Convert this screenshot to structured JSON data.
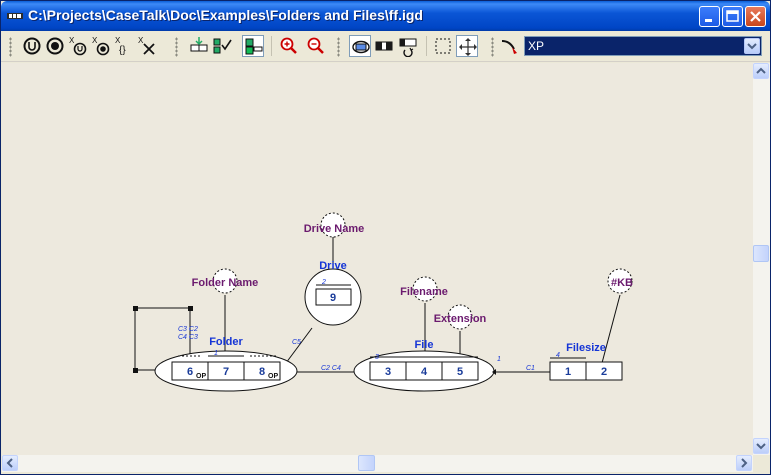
{
  "window": {
    "title": "C:\\Projects\\CaseTalk\\Doc\\Examples\\Folders and Files\\ff.igd"
  },
  "toolbar": {
    "style_combo": {
      "value": "XP"
    }
  },
  "diagram": {
    "object_labels": {
      "drive_name": "Drive Name",
      "drive": "Drive",
      "folder_name": "Folder Name",
      "filename": "Filename",
      "extension": "Extension",
      "kb": "#KB",
      "folder": "Folder",
      "file": "File",
      "filesize": "Filesize"
    },
    "roles": {
      "folder": [
        "6",
        "7",
        "8"
      ],
      "drive": [
        "9"
      ],
      "file": [
        "3",
        "4",
        "5"
      ],
      "filesize": [
        "1",
        "2"
      ]
    },
    "annotations": {
      "folder_constraints_1": "C3 C2",
      "folder_constraints_2": "C4 C3",
      "folder_op_1": "OP",
      "folder_op_2": "OP",
      "drive_link": "C5",
      "folder_file_link": "C2 C4",
      "file_filesize_link": "C1",
      "uniq_folder": "1",
      "uniq_drive": "2",
      "uniq_file": "3",
      "uniq_file_right": "1",
      "uniq_filesize": "4"
    }
  }
}
